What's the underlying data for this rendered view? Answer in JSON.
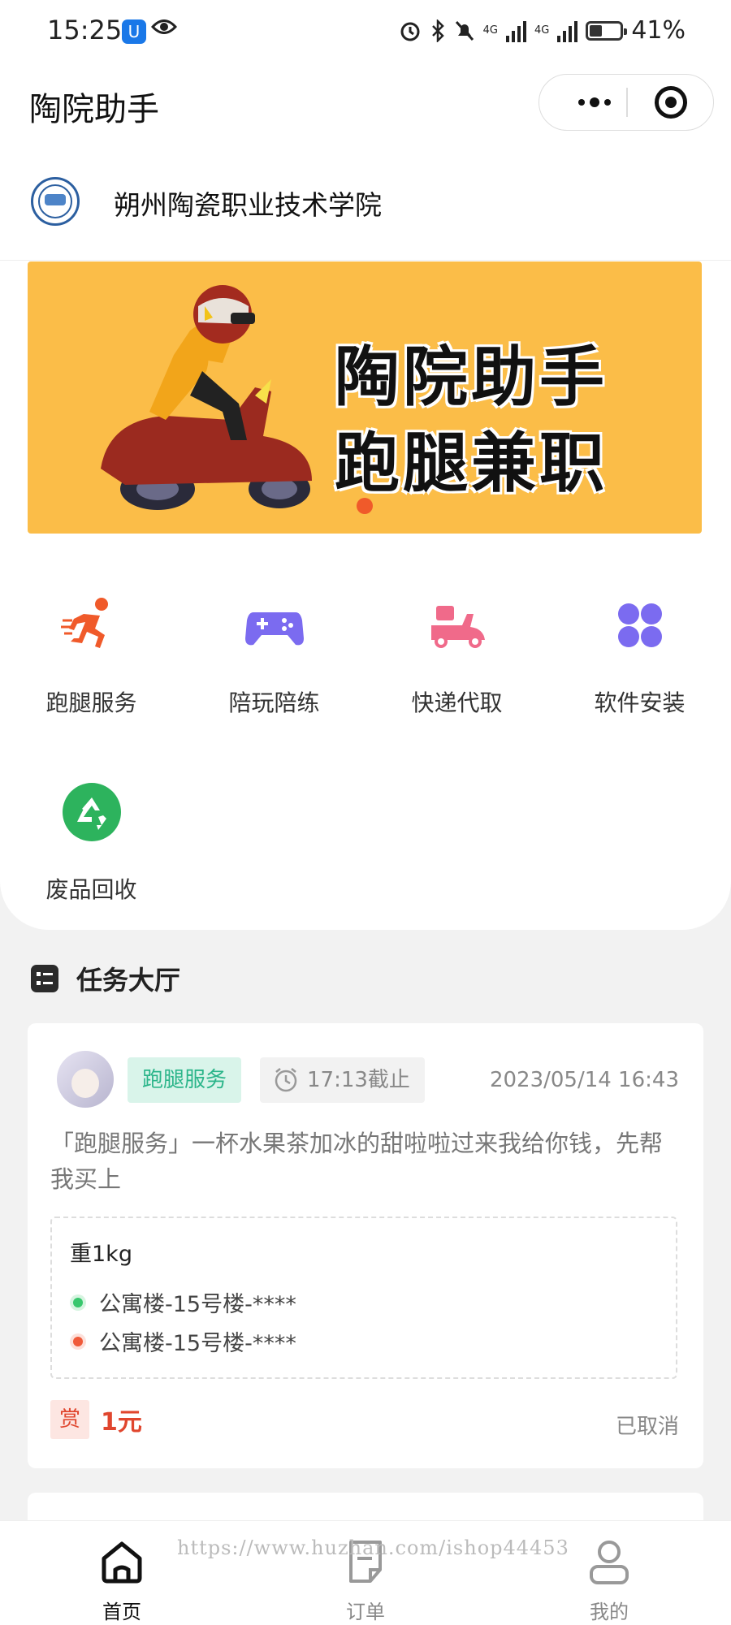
{
  "status_bar": {
    "time": "15:25",
    "app_badge": "U",
    "network_1": "4G",
    "network_2": "4G",
    "battery_percent": "41%",
    "battery_level": 0.41
  },
  "navbar": {
    "title": "陶院助手"
  },
  "school": {
    "name": "朔州陶瓷职业技术学院"
  },
  "banner": {
    "line1": "陶院助手",
    "line2": "跑腿兼职",
    "accent": "#fbbd48"
  },
  "services": [
    {
      "label": "跑腿服务",
      "icon": "runner-icon",
      "color": "#f05a2a"
    },
    {
      "label": "陪玩陪练",
      "icon": "gamepad-icon",
      "color": "#7b6bf0"
    },
    {
      "label": "快递代取",
      "icon": "scooter-icon",
      "color": "#f06a8a"
    },
    {
      "label": "软件安装",
      "icon": "apps-grid-icon",
      "color": "#7b6bf0"
    },
    {
      "label": "废品回收",
      "icon": "recycle-icon",
      "color": "#2db35d"
    }
  ],
  "task_hall": {
    "title": "任务大厅"
  },
  "task": {
    "service_tag": "跑腿服务",
    "deadline": "17:13截止",
    "posted": "2023/05/14 16:43",
    "description": "「跑腿服务」一杯水果茶加冰的甜啦啦过来我给你钱，先帮我买上",
    "weight": "重1kg",
    "from_address": "公寓楼-15号楼-****",
    "to_address": "公寓楼-15号楼-****",
    "reward_label": "赏",
    "reward_amount": "1元",
    "status": "已取消"
  },
  "tabbar": {
    "home": "首页",
    "orders": "订单",
    "mine": "我的"
  },
  "watermark": "https://www.huzhan.com/ishop44453"
}
